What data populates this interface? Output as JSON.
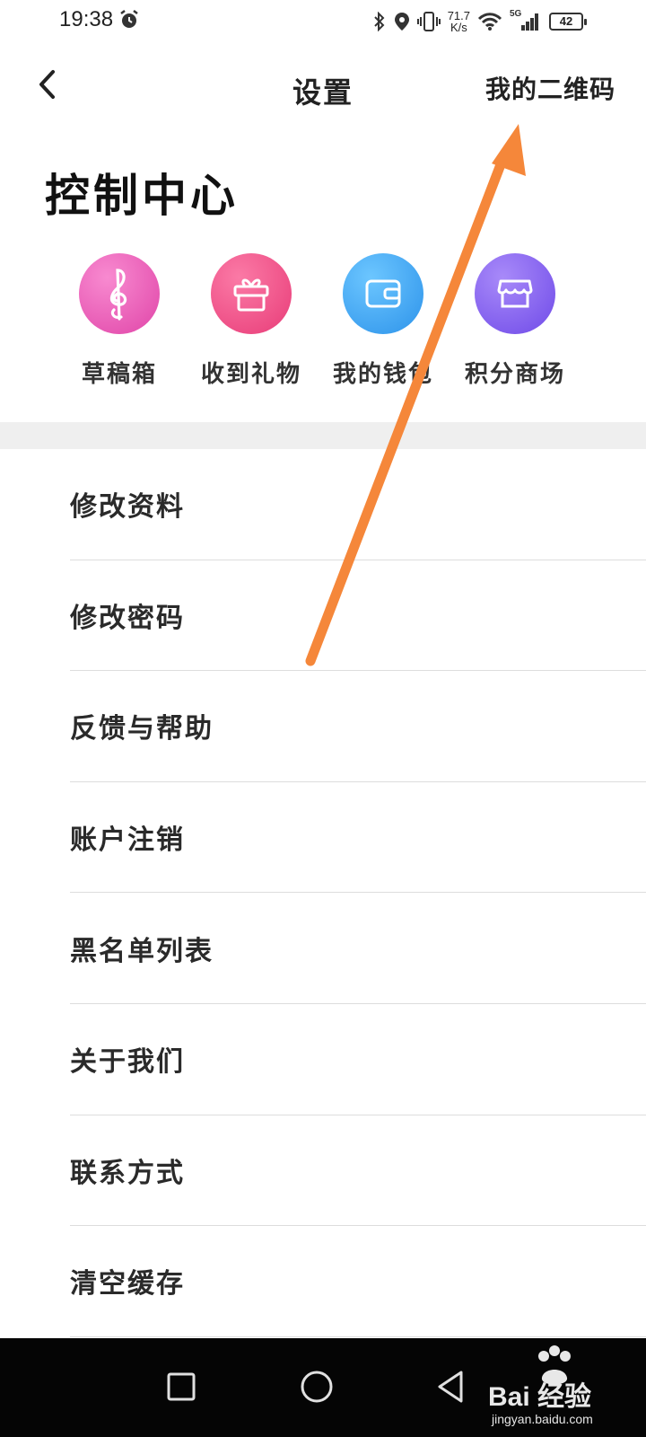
{
  "status_bar": {
    "time": "19:38",
    "net_speed_value": "71.7",
    "net_speed_unit": "K/s",
    "network_type": "5G",
    "battery": "42"
  },
  "nav": {
    "title": "设置",
    "qr_link": "我的二维码"
  },
  "control_center": {
    "heading": "控制中心",
    "shortcuts": [
      {
        "label": "草稿箱",
        "icon": "treble-clef-icon",
        "color": "#ec5cb2"
      },
      {
        "label": "收到礼物",
        "icon": "gift-icon",
        "color": "#f0508a"
      },
      {
        "label": "我的钱包",
        "icon": "wallet-icon",
        "color": "#3aa8f5"
      },
      {
        "label": "积分商场",
        "icon": "store-icon",
        "color": "#7f5ef0"
      }
    ]
  },
  "settings": {
    "items": [
      {
        "label": "修改资料"
      },
      {
        "label": "修改密码"
      },
      {
        "label": "反馈与帮助"
      },
      {
        "label": "账户注销"
      },
      {
        "label": "黑名单列表"
      },
      {
        "label": "关于我们"
      },
      {
        "label": "联系方式"
      },
      {
        "label": "清空缓存"
      }
    ]
  },
  "annotation": {
    "color": "#f5873a"
  },
  "watermark": {
    "brand": "Bai 经验",
    "url": "jingyan.baidu.com"
  }
}
